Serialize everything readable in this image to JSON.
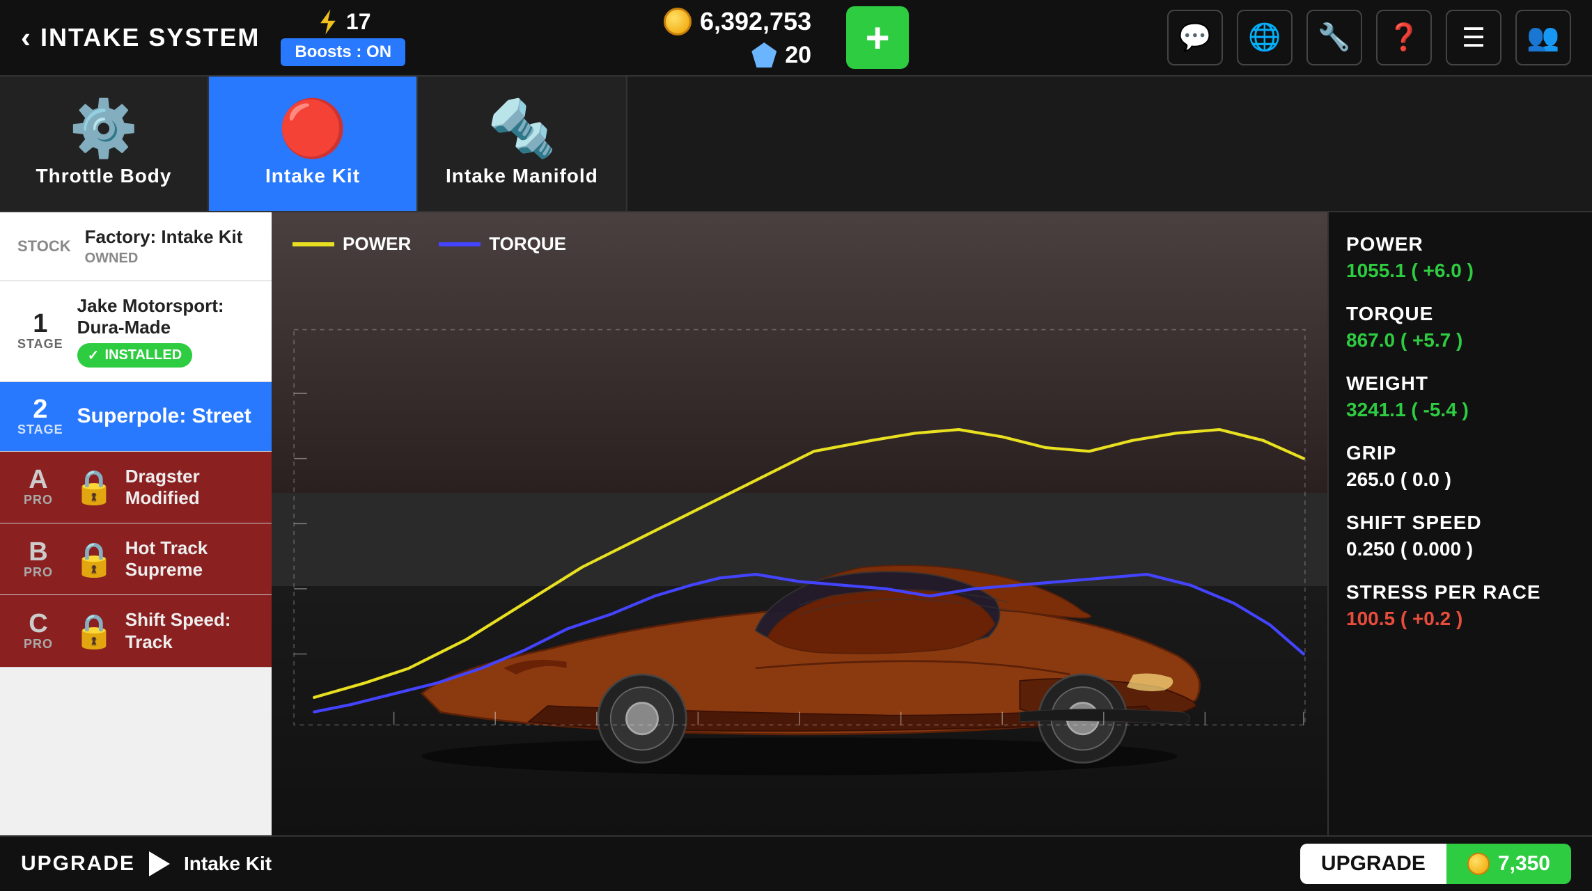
{
  "header": {
    "back_label": "INTAKE SYSTEM",
    "lightning_count": "17",
    "boosts_label": "Boosts : ON",
    "coins": "6,392,753",
    "diamonds": "20",
    "add_label": "+"
  },
  "header_icons": [
    {
      "name": "chat-icon",
      "symbol": "💬"
    },
    {
      "name": "globe-icon",
      "symbol": "🌐"
    },
    {
      "name": "wrench-icon",
      "symbol": "🔧"
    },
    {
      "name": "question-icon",
      "symbol": "❓"
    },
    {
      "name": "menu-icon",
      "symbol": "☰"
    },
    {
      "name": "people-icon",
      "symbol": "👥"
    }
  ],
  "tabs": [
    {
      "id": "throttle-body",
      "label": "Throttle Body",
      "active": false
    },
    {
      "id": "intake-kit",
      "label": "Intake Kit",
      "active": true
    },
    {
      "id": "intake-manifold",
      "label": "Intake Manifold",
      "active": false
    }
  ],
  "upgrade_items": [
    {
      "id": "stock",
      "type": "stock",
      "stage_label": "STOCK",
      "name": "Factory: Intake Kit",
      "sub": "OWNED",
      "locked": false,
      "selected": false
    },
    {
      "id": "stage1",
      "type": "stage",
      "stage_num": "1",
      "stage_text": "STAGE",
      "name": "Jake Motorsport: Dura-Made",
      "sub": "INSTALLED",
      "locked": false,
      "selected": false
    },
    {
      "id": "stage2",
      "type": "stage",
      "stage_num": "2",
      "stage_text": "STAGE",
      "name": "Superpole: Street",
      "sub": "",
      "locked": false,
      "selected": true
    },
    {
      "id": "pro-a",
      "type": "pro",
      "stage_num": "A",
      "stage_text": "PRO",
      "name": "Dragster Modified",
      "locked": true,
      "selected": false
    },
    {
      "id": "pro-b",
      "type": "pro",
      "stage_num": "B",
      "stage_text": "PRO",
      "name": "Hot Track Supreme",
      "locked": true,
      "selected": false
    },
    {
      "id": "pro-c",
      "type": "pro",
      "stage_num": "C",
      "stage_text": "PRO",
      "name": "Shift Speed: Track",
      "locked": true,
      "selected": false
    }
  ],
  "chart": {
    "legend": {
      "power_label": "POWER",
      "torque_label": "TORQUE"
    }
  },
  "stats": {
    "power_label": "POWER",
    "power_value": "1055.1 ( +6.0 )",
    "torque_label": "TORQUE",
    "torque_value": "867.0 ( +5.7 )",
    "weight_label": "WEIGHT",
    "weight_value": "3241.1 ( -5.4 )",
    "grip_label": "GRIP",
    "grip_value": "265.0 ( 0.0 )",
    "shift_speed_label": "SHIFT SPEED",
    "shift_speed_value": "0.250 ( 0.000 )",
    "stress_label": "STRESS PER RACE",
    "stress_value": "100.5 ( +0.2 )"
  },
  "bottom_bar": {
    "upgrade_label": "UPGRADE",
    "item_name": "Intake Kit",
    "upgrade_btn_label": "UPGRADE",
    "price": "7,350"
  }
}
